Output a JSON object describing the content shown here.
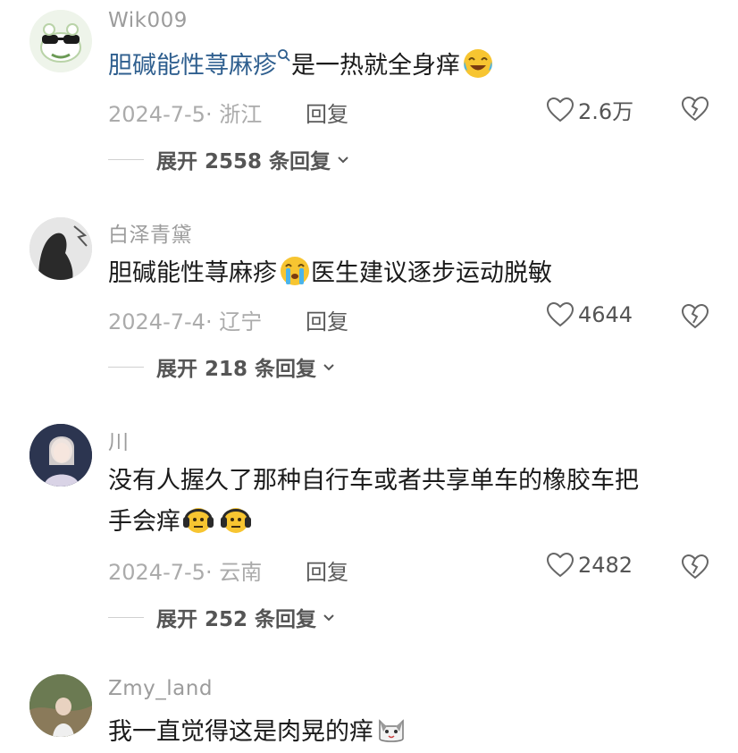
{
  "comments": [
    {
      "username": "Wik009",
      "text_link": "胆碱能性荨麻疹",
      "text_rest": "是一热就全身痒",
      "date_location": "2024-7-5· 浙江",
      "reply_label": "回复",
      "likes": "2.6万",
      "expand_label": "展开 2558 条回复"
    },
    {
      "username": "白泽青黛",
      "text_a": "胆碱能性荨麻疹",
      "text_b": "医生建议逐步运动脱敏",
      "date_location": "2024-7-4· 辽宁",
      "reply_label": "回复",
      "likes": "4644",
      "expand_label": "展开 218 条回复"
    },
    {
      "username": "川",
      "line1": "没有人握久了那种自行车或者共享单车的橡胶车把",
      "line2": "手会痒",
      "date_location": "2024-7-5· 云南",
      "reply_label": "回复",
      "likes": "2482",
      "expand_label": "展开 252 条回复"
    },
    {
      "username": "Zmy_land",
      "text": "我一直觉得这是肉晃的痒"
    }
  ],
  "icons": {
    "like": "heart-outline-icon",
    "dislike": "broken-heart-icon",
    "expand": "chevron-down-icon",
    "search": "search-icon"
  },
  "colors": {
    "link": "#2f5f8f",
    "meta": "#ababab",
    "text": "#1b1b1b"
  }
}
